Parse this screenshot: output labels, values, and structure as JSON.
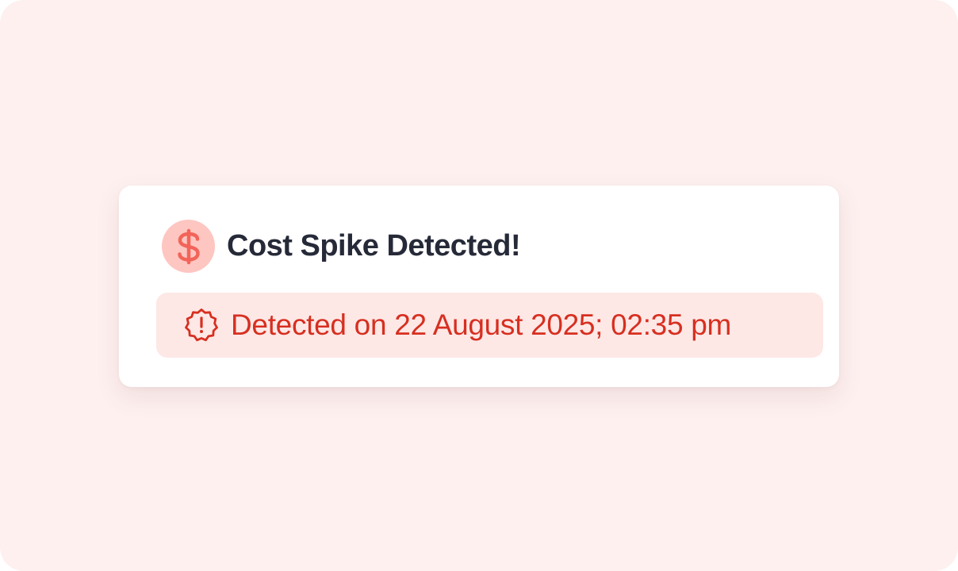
{
  "notification": {
    "title": "Cost Spike Detected!",
    "icon": "dollar-icon",
    "detected_text": "Detected on 22 August 2025; 02:35 pm",
    "alert_icon": "alert-badge-icon"
  },
  "colors": {
    "background": "#fdf0ef",
    "card": "#ffffff",
    "icon_circle": "#fec6c1",
    "icon_glyph": "#f2645a",
    "title": "#262a38",
    "banner_bg": "#fde8e6",
    "banner_text": "#d72f20"
  }
}
